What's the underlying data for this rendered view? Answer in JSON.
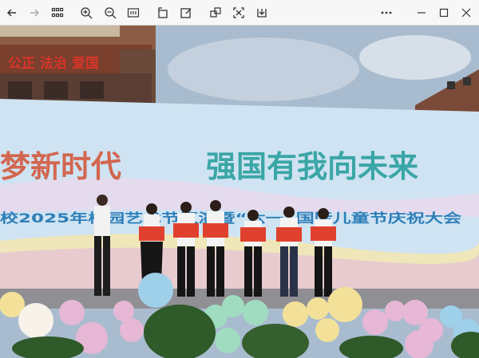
{
  "toolbar": {
    "buttons": [
      {
        "name": "back-arrow-icon"
      },
      {
        "name": "forward-arrow-icon"
      },
      {
        "name": "grid-view-icon"
      },
      {
        "name": "zoom-in-icon"
      },
      {
        "name": "zoom-out-icon"
      },
      {
        "name": "actual-size-icon"
      },
      {
        "name": "rotate-icon"
      },
      {
        "name": "edit-icon"
      },
      {
        "name": "copy-icon"
      },
      {
        "name": "scan-icon"
      },
      {
        "name": "download-icon"
      },
      {
        "name": "more-icon"
      },
      {
        "name": "minimize-icon"
      },
      {
        "name": "maximize-icon"
      },
      {
        "name": "close-icon"
      }
    ]
  },
  "photo": {
    "building_slogan": "公正 法治 爱国",
    "banner_line1_left": "梦新时代",
    "banner_line1_right": "强国有我向未来",
    "banner_line2": "校2025年校园艺术节汇演暨“六一”国际儿童节庆祝大会",
    "colors": {
      "sky": "#a9bccf",
      "banner": "#cfe3f2",
      "slogan_red": "#d8352a",
      "balloon_yellow": "#f3e19a",
      "balloon_pink": "#e7b7d6",
      "balloon_blue": "#9fd0ea",
      "balloon_green": "#9fdcc0"
    }
  }
}
